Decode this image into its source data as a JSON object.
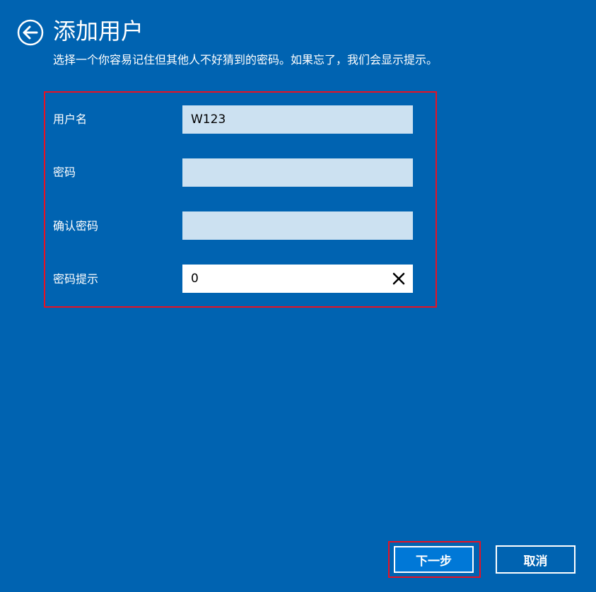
{
  "header": {
    "title": "添加用户",
    "subtitle": "选择一个你容易记住但其他人不好猜到的密码。如果忘了，我们会显示提示。"
  },
  "form": {
    "username": {
      "label": "用户名",
      "value": "W123"
    },
    "password": {
      "label": "密码",
      "value": ""
    },
    "confirm_password": {
      "label": "确认密码",
      "value": ""
    },
    "password_hint": {
      "label": "密码提示",
      "value": "0"
    }
  },
  "footer": {
    "next_label": "下一步",
    "cancel_label": "取消"
  },
  "icons": {
    "back": "back-arrow-circle-icon",
    "clear": "close-icon"
  },
  "colors": {
    "background": "#0063b1",
    "primary_button": "#0078d7",
    "input_background": "#cce1f1",
    "highlight": "#e81123"
  }
}
